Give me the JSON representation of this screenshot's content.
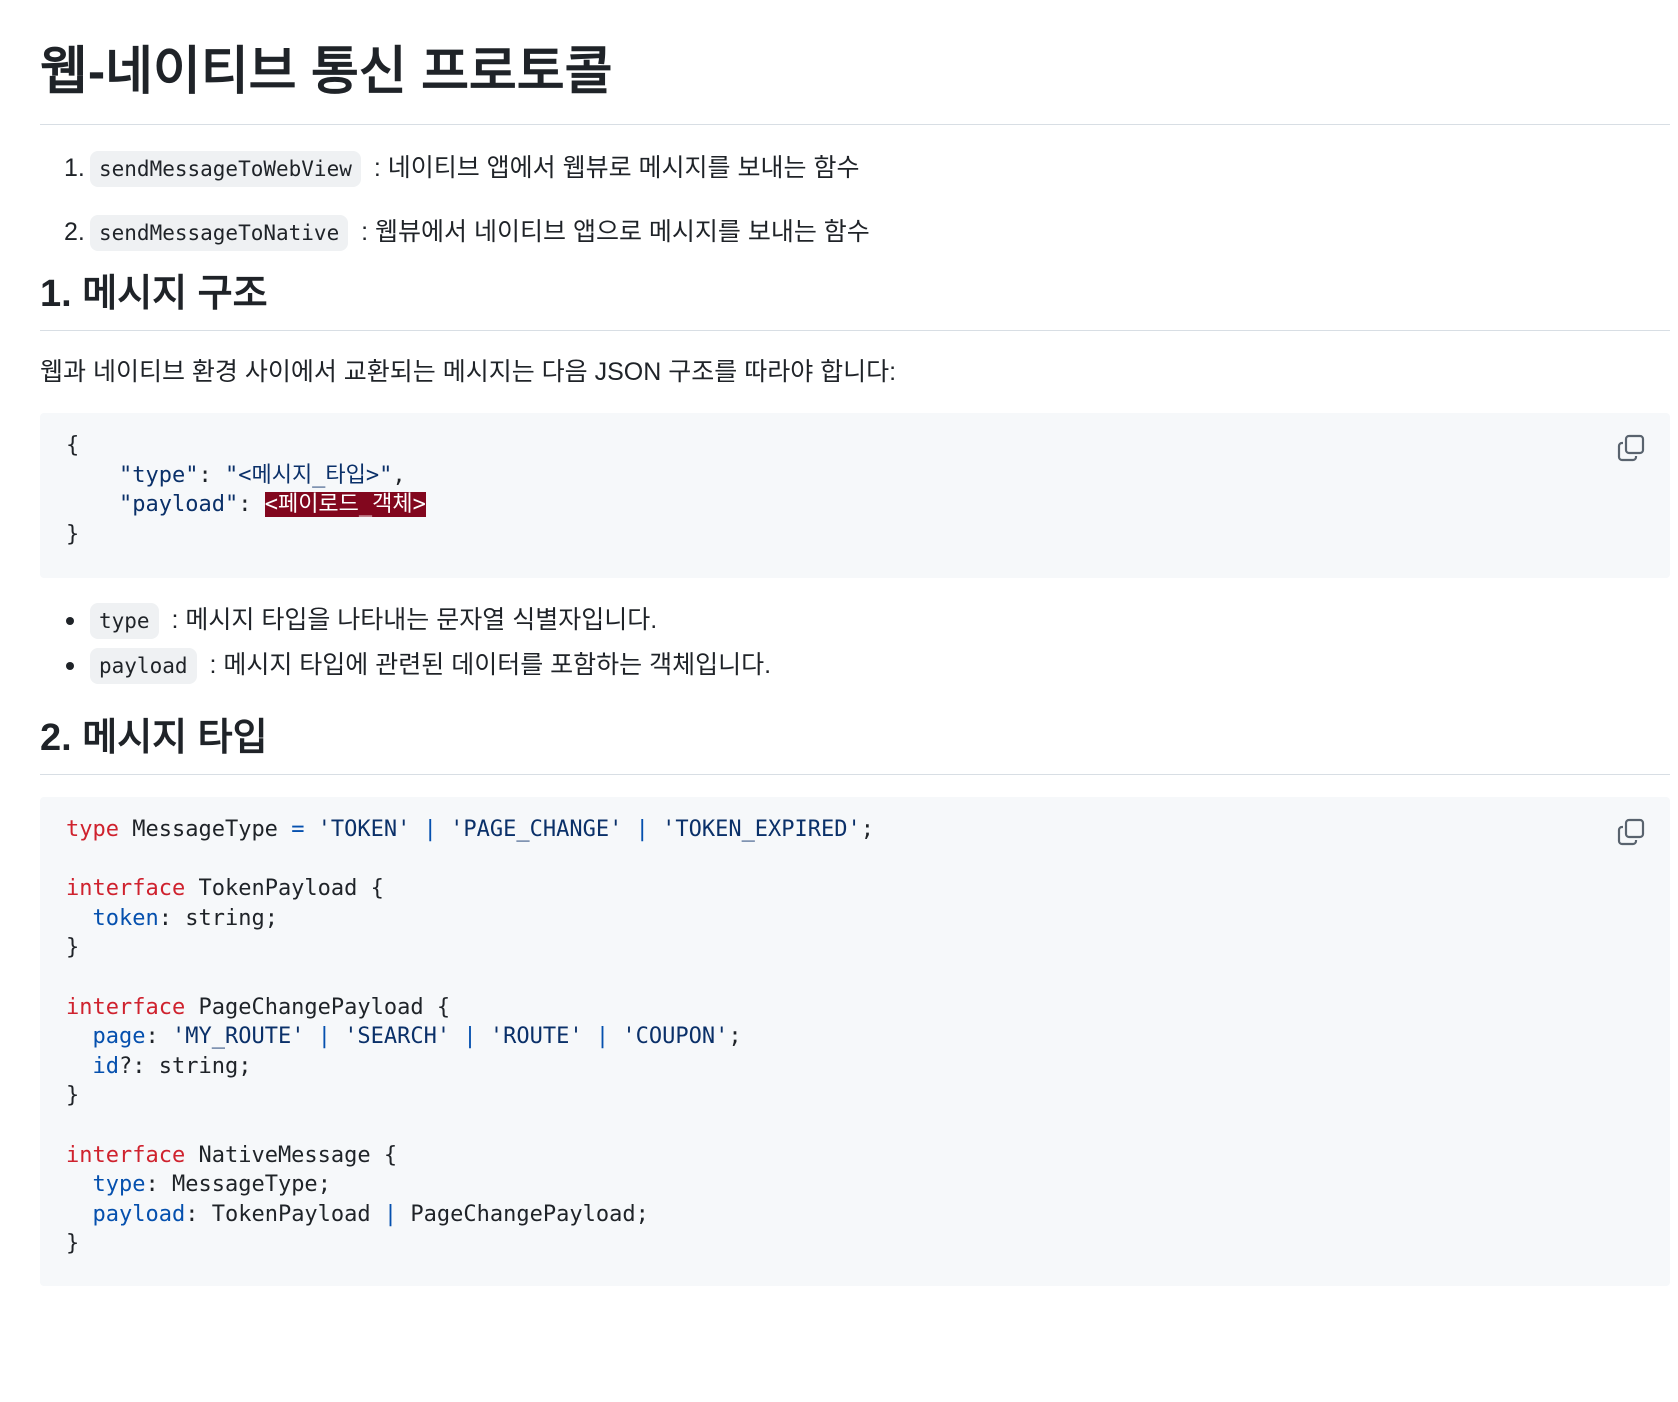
{
  "title": "웹-네이티브 통신 프로토콜",
  "intro_list": [
    {
      "num": "1.",
      "code": "sendMessageToWebView",
      "text": " : 네이티브 앱에서 웹뷰로 메시지를 보내는 함수"
    },
    {
      "num": "2.",
      "code": "sendMessageToNative",
      "text": " : 웹뷰에서 네이티브 앱으로 메시지를 보내는 함수"
    }
  ],
  "section1": {
    "heading": "1. 메시지 구조",
    "paragraph": "웹과 네이티브 환경 사이에서 교환되는 메시지는 다음 JSON 구조를 따라야 합니다:",
    "code": {
      "open_brace": "{",
      "type_key": "\"type\"",
      "type_value": "\"<메시지_타입>\"",
      "payload_key": "\"payload\"",
      "payload_value": "<페이로드_객체>",
      "close_brace": "}"
    },
    "bullets": [
      {
        "code": "type",
        "text": " : 메시지 타입을 나타내는 문자열 식별자입니다."
      },
      {
        "code": "payload",
        "text": " : 메시지 타입에 관련된 데이터를 포함하는 객체입니다."
      }
    ]
  },
  "section2": {
    "heading": "2. 메시지 타입",
    "code": {
      "kw_type": "type",
      "kw_interface": "interface",
      "message_type_name": "MessageType",
      "token_literal": "'TOKEN'",
      "page_change_literal": "'PAGE_CHANGE'",
      "token_expired_literal": "'TOKEN_EXPIRED'",
      "token_payload_name": "TokenPayload",
      "token_field": "token",
      "string_type": "string",
      "page_change_payload_name": "PageChangePayload",
      "page_field": "page",
      "my_route_literal": "'MY_ROUTE'",
      "search_literal": "'SEARCH'",
      "route_literal": "'ROUTE'",
      "coupon_literal": "'COUPON'",
      "id_field": "id",
      "native_message_name": "NativeMessage",
      "type_field": "type",
      "payload_field": "payload"
    }
  },
  "icons": {
    "copy": "copy-icon"
  }
}
